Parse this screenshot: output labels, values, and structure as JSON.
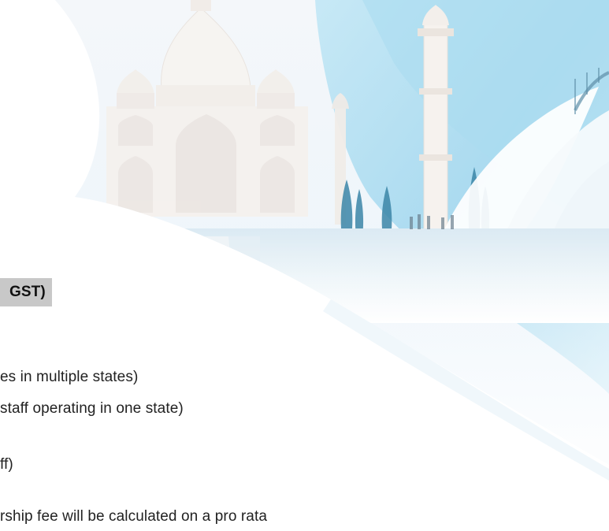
{
  "document": {
    "heading_fragment": "GST)",
    "lines": [
      "es in multiple states)",
      "staff operating in one state)",
      "ff)",
      "rship fee will be calculated on a pro rata"
    ]
  },
  "colors": {
    "background": "#ffffff",
    "text": "#222222",
    "heading_highlight": "#c8c8c8",
    "sky_light": "#eef5fb",
    "sky_blue": "#bfe3f3",
    "cyan_band": "#9fd6ee",
    "monument": "#f4f1ee",
    "cypress": "#3c86a8"
  },
  "background_image": {
    "subject": "taj-mahal-and-opera-house-collage"
  }
}
